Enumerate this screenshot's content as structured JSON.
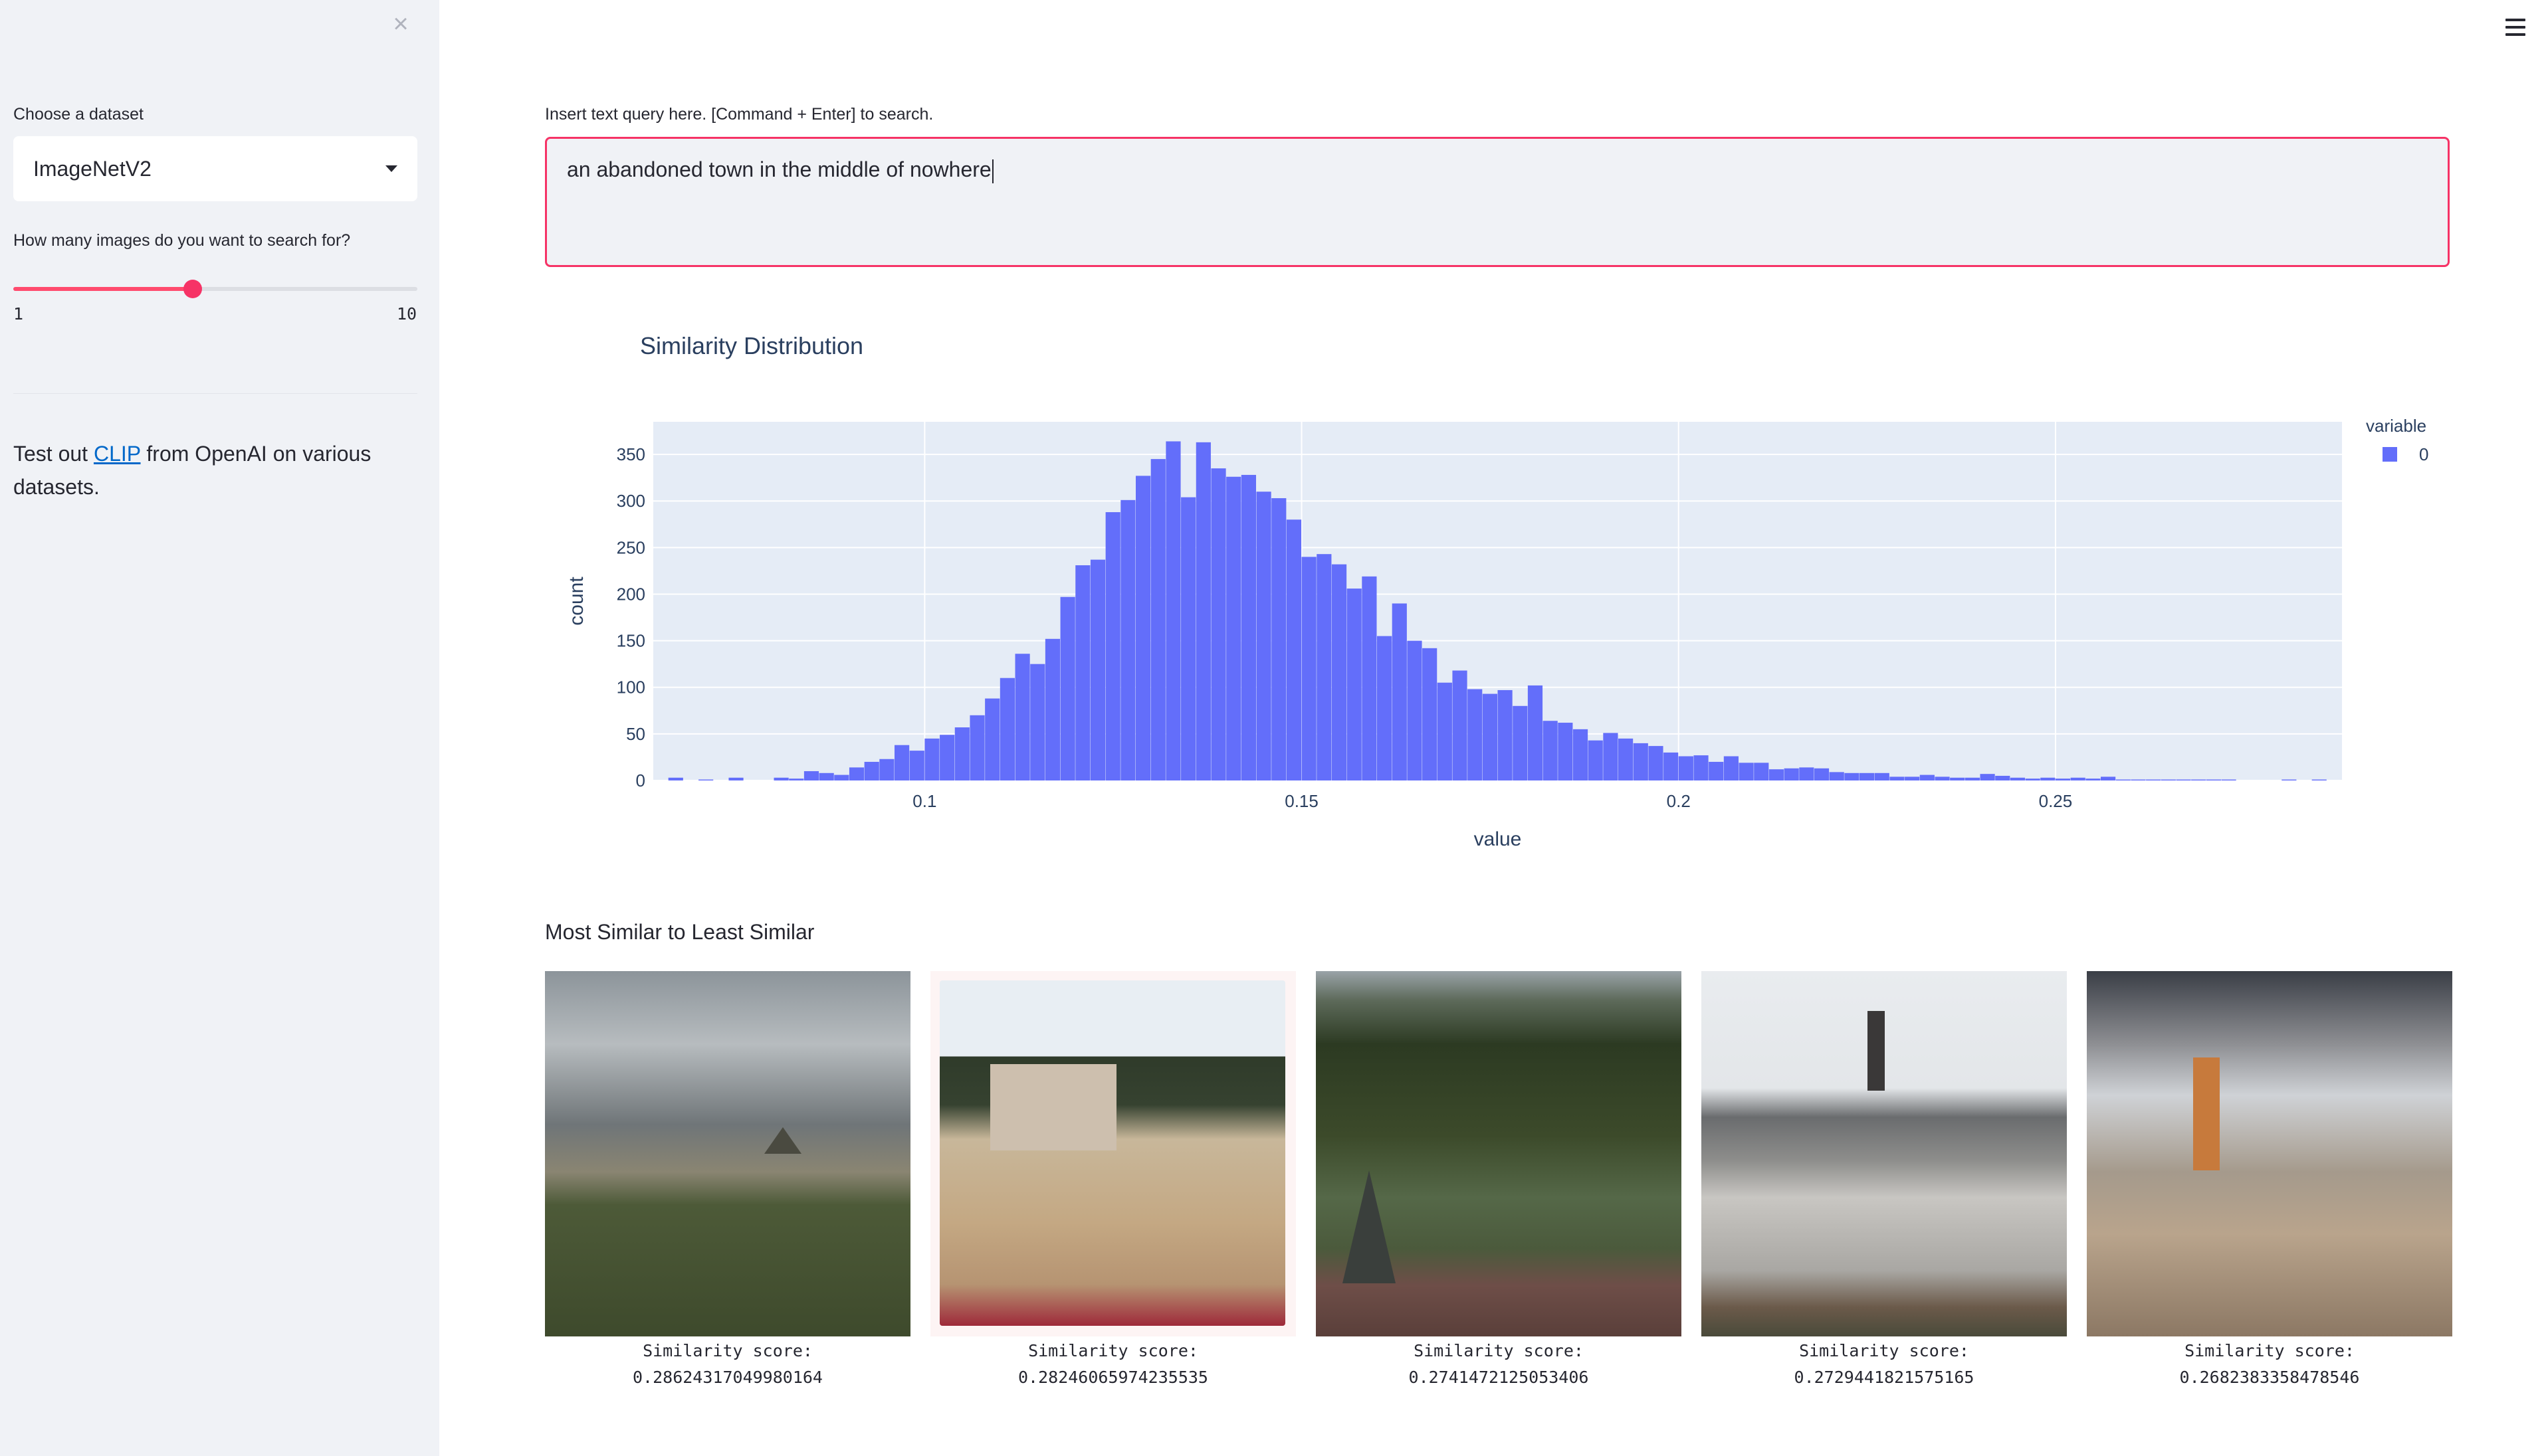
{
  "sidebar": {
    "dataset_label": "Choose a dataset",
    "dataset_value": "ImageNetV2",
    "count_label": "How many images do you want to search for?",
    "slider": {
      "min": "1",
      "max": "10",
      "value": 5
    },
    "intro": {
      "prefix": "Test out ",
      "link": "CLIP",
      "suffix": " from OpenAI on various datasets."
    }
  },
  "query": {
    "label": "Insert text query here. [Command + Enter] to search.",
    "value": "an abandoned town in the middle of nowhere"
  },
  "chart": {
    "title": "Similarity Distribution"
  },
  "chart_data": {
    "type": "bar",
    "title": "Similarity Distribution",
    "xlabel": "value",
    "ylabel": "count",
    "legend_title": "variable",
    "series": [
      {
        "name": "0",
        "color": "#636efa"
      }
    ],
    "x_start": 0.064,
    "bin_width": 0.002,
    "xlim": [
      0.064,
      0.288
    ],
    "ylim": [
      0,
      385
    ],
    "x_ticks": [
      "0.1",
      "0.15",
      "0.2",
      "0.25"
    ],
    "x_tick_values": [
      0.1,
      0.15,
      0.2,
      0.25
    ],
    "y_ticks": [
      "0",
      "50",
      "100",
      "150",
      "200",
      "250",
      "300",
      "350"
    ],
    "y_tick_values": [
      0,
      50,
      100,
      150,
      200,
      250,
      300,
      350
    ],
    "legend_position": "top-right",
    "grid": true,
    "values": [
      0,
      3,
      0,
      1,
      0,
      3,
      0,
      0,
      3,
      2,
      10,
      8,
      6,
      14,
      20,
      23,
      38,
      32,
      45,
      49,
      57,
      70,
      88,
      110,
      136,
      125,
      152,
      197,
      231,
      237,
      288,
      301,
      327,
      345,
      364,
      304,
      363,
      335,
      326,
      328,
      310,
      303,
      280,
      240,
      243,
      232,
      206,
      219,
      155,
      190,
      150,
      142,
      105,
      118,
      98,
      93,
      97,
      80,
      102,
      64,
      62,
      55,
      43,
      51,
      45,
      40,
      37,
      30,
      26,
      27,
      20,
      26,
      19,
      19,
      12,
      13,
      14,
      13,
      9,
      8,
      8,
      8,
      4,
      4,
      6,
      4,
      3,
      3,
      7,
      5,
      3,
      2,
      3,
      2,
      3,
      2,
      4,
      1,
      1,
      1,
      1,
      1,
      1,
      1,
      1,
      0,
      0,
      0,
      1,
      0,
      1,
      0
    ]
  },
  "results": {
    "title": "Most Similar to Least Similar",
    "items": [
      {
        "caption_label": "Similarity score:",
        "score": "0.28624317049980164"
      },
      {
        "caption_label": "Similarity score:",
        "score": "0.28246065974235535"
      },
      {
        "caption_label": "Similarity score:",
        "score": "0.2741472125053406"
      },
      {
        "caption_label": "Similarity score:",
        "score": "0.2729441821575165"
      },
      {
        "caption_label": "Similarity score:",
        "score": "0.2682383358478546"
      }
    ]
  }
}
